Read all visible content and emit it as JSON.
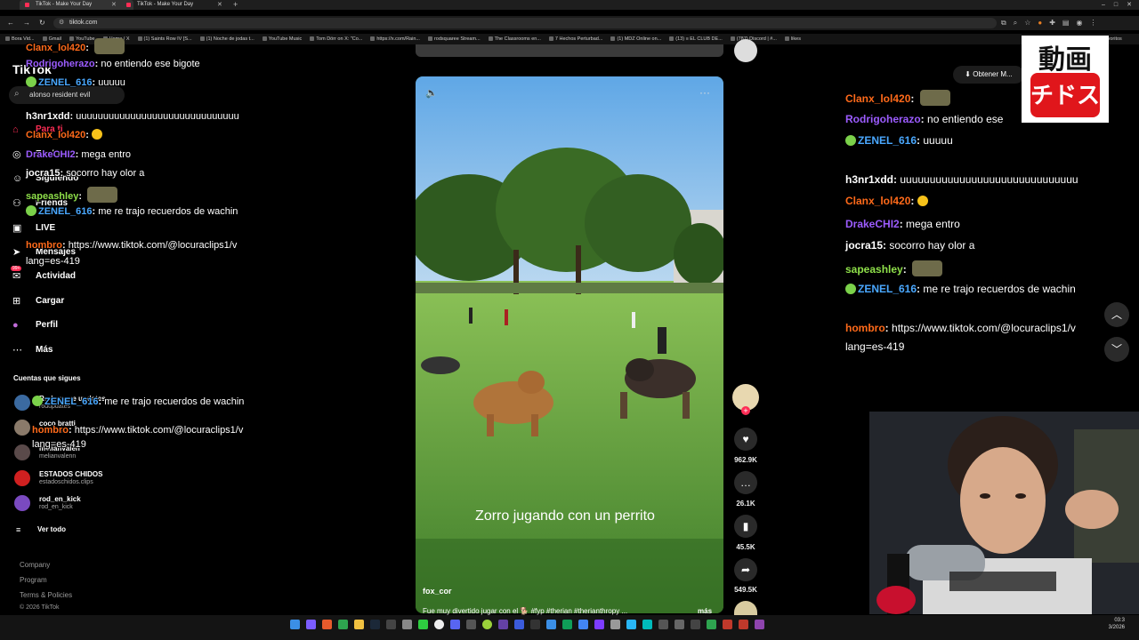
{
  "browser": {
    "tabs": [
      {
        "title": "TikTok - Make Your Day",
        "active": true
      },
      {
        "title": "TikTok - Make Your Day",
        "active": false
      }
    ],
    "url": "tiktok.com",
    "bookmarks": [
      "Bora Vid...",
      "Gmail",
      "YouTube",
      "Home / X",
      "(1) Saints Row IV [S...",
      "(1) Noche de jodas t...",
      "YouTube Music",
      "Tom Dörr on X: \"Co...",
      "https://x.com/Rain...",
      "rodsquaree Stream...",
      "The Classrooms en...",
      "7 Hechos Perturbad...",
      "(1) MDZ Online on...",
      "(13) ≡ EL CLUB DE...",
      "(787) Discord | #...",
      "likes"
    ],
    "bookmarks_more": "favoritos"
  },
  "tiktok": {
    "logo": "TikTok",
    "search_value": "alonso resident evil",
    "nav": [
      {
        "label": "Para ti",
        "icon": "home-icon"
      },
      {
        "label": "Explorar",
        "icon": "compass-icon"
      },
      {
        "label": "Siguiendo",
        "icon": "following-icon"
      },
      {
        "label": "Friends",
        "icon": "friends-icon"
      },
      {
        "label": "LIVE",
        "icon": "live-icon"
      },
      {
        "label": "Mensajes",
        "icon": "send-icon"
      },
      {
        "label": "Actividad",
        "icon": "inbox-icon",
        "badge": "99+"
      },
      {
        "label": "Cargar",
        "icon": "upload-icon"
      },
      {
        "label": "Perfil",
        "icon": "profile-icon"
      },
      {
        "label": "Más",
        "icon": "more-icon"
      }
    ],
    "following_title": "Cuentas que sigues",
    "following": [
      {
        "name": "Rodsquare updates",
        "handle": "rodupdates"
      },
      {
        "name": "coco bratti",
        "handle": "coco.bratti"
      },
      {
        "name": "melianvalen",
        "handle": "melianvalenn"
      },
      {
        "name": "ESTADOS CHIDOS",
        "handle": "estadoschidos.clips"
      },
      {
        "name": "rod_en_kick",
        "handle": "rod_en_kick"
      }
    ],
    "see_all": "Ver todo",
    "footer": [
      "Company",
      "Program",
      "Terms & Policies",
      "© 2026 TikTok"
    ],
    "get_app": "Obtener M...",
    "video": {
      "caption": "Zorro jugando con un perrito",
      "author": "fox_cor",
      "description": "Fue muy divertido jugar con el 🐕     #fyp #therian #therianthropy ...",
      "more": "más"
    },
    "actions": [
      {
        "icon": "heart-icon",
        "count": "962.9K"
      },
      {
        "icon": "comment-icon",
        "count": "26.1K"
      },
      {
        "icon": "bookmark-icon",
        "count": "45.5K"
      },
      {
        "icon": "share-icon",
        "count": "549.5K"
      }
    ]
  },
  "chat_left": [
    {
      "user": "Clanx_lol420",
      "msg": ""
    },
    {
      "user": "Rodrigoherazo",
      "msg": "no entiendo ese bigote"
    },
    {
      "user": "ZENEL_616",
      "msg": "uuuuu"
    },
    {
      "user": "h3nr1xdd",
      "msg": "uuuuuuuuuuuuuuuuuuuuuuuuuuuuuu"
    },
    {
      "user": "Clanx_lol420",
      "msg": ""
    },
    {
      "user": "DrakeCHI2",
      "msg": "mega entro"
    },
    {
      "user": "jocra15",
      "msg": "socorro hay olor a"
    },
    {
      "user": "sapeashley",
      "msg": ""
    },
    {
      "user": "ZENEL_616",
      "msg": "me re trajo recuerdos de wachin"
    },
    {
      "user": "hombro",
      "msg": "https://www.tiktok.com/@locuraclips1/v"
    },
    {
      "user": "",
      "msg": "lang=es-419"
    }
  ],
  "chat_left_lower": [
    {
      "user": "ZENEL_616",
      "msg": "me re trajo recuerdos de wachin"
    },
    {
      "user": "hombro",
      "msg": "https://www.tiktok.com/@locuraclips1/v"
    },
    {
      "user": "",
      "msg": "lang=es-419"
    }
  ],
  "chat_right": [
    {
      "user": "Clanx_lol420",
      "msg": ""
    },
    {
      "user": "Rodrigoherazo",
      "msg": "no entiendo ese"
    },
    {
      "user": "ZENEL_616",
      "msg": "uuuuu"
    },
    {
      "user": "h3nr1xdd",
      "msg": "uuuuuuuuuuuuuuuuuuuuuuuuuuuuuu"
    },
    {
      "user": "Clanx_lol420",
      "msg": ""
    },
    {
      "user": "DrakeCHI2",
      "msg": "mega entro"
    },
    {
      "user": "jocra15",
      "msg": "socorro hay olor a"
    },
    {
      "user": "sapeashley",
      "msg": ""
    },
    {
      "user": "ZENEL_616",
      "msg": "me re trajo recuerdos de wachin"
    },
    {
      "user": "hombro",
      "msg": "https://www.tiktok.com/@locuraclips1/v"
    },
    {
      "user": "",
      "msg": "lang=es-419"
    }
  ],
  "badge": {
    "top": "動画",
    "bottom": "チドス"
  },
  "taskbar": {
    "time": "03:3",
    "date": "3/2026"
  },
  "colors": {
    "accent": "#ff2d55",
    "username_orange": "#ff6a1a",
    "username_purple": "#9c5cff",
    "username_blue": "#4aa8ff"
  }
}
